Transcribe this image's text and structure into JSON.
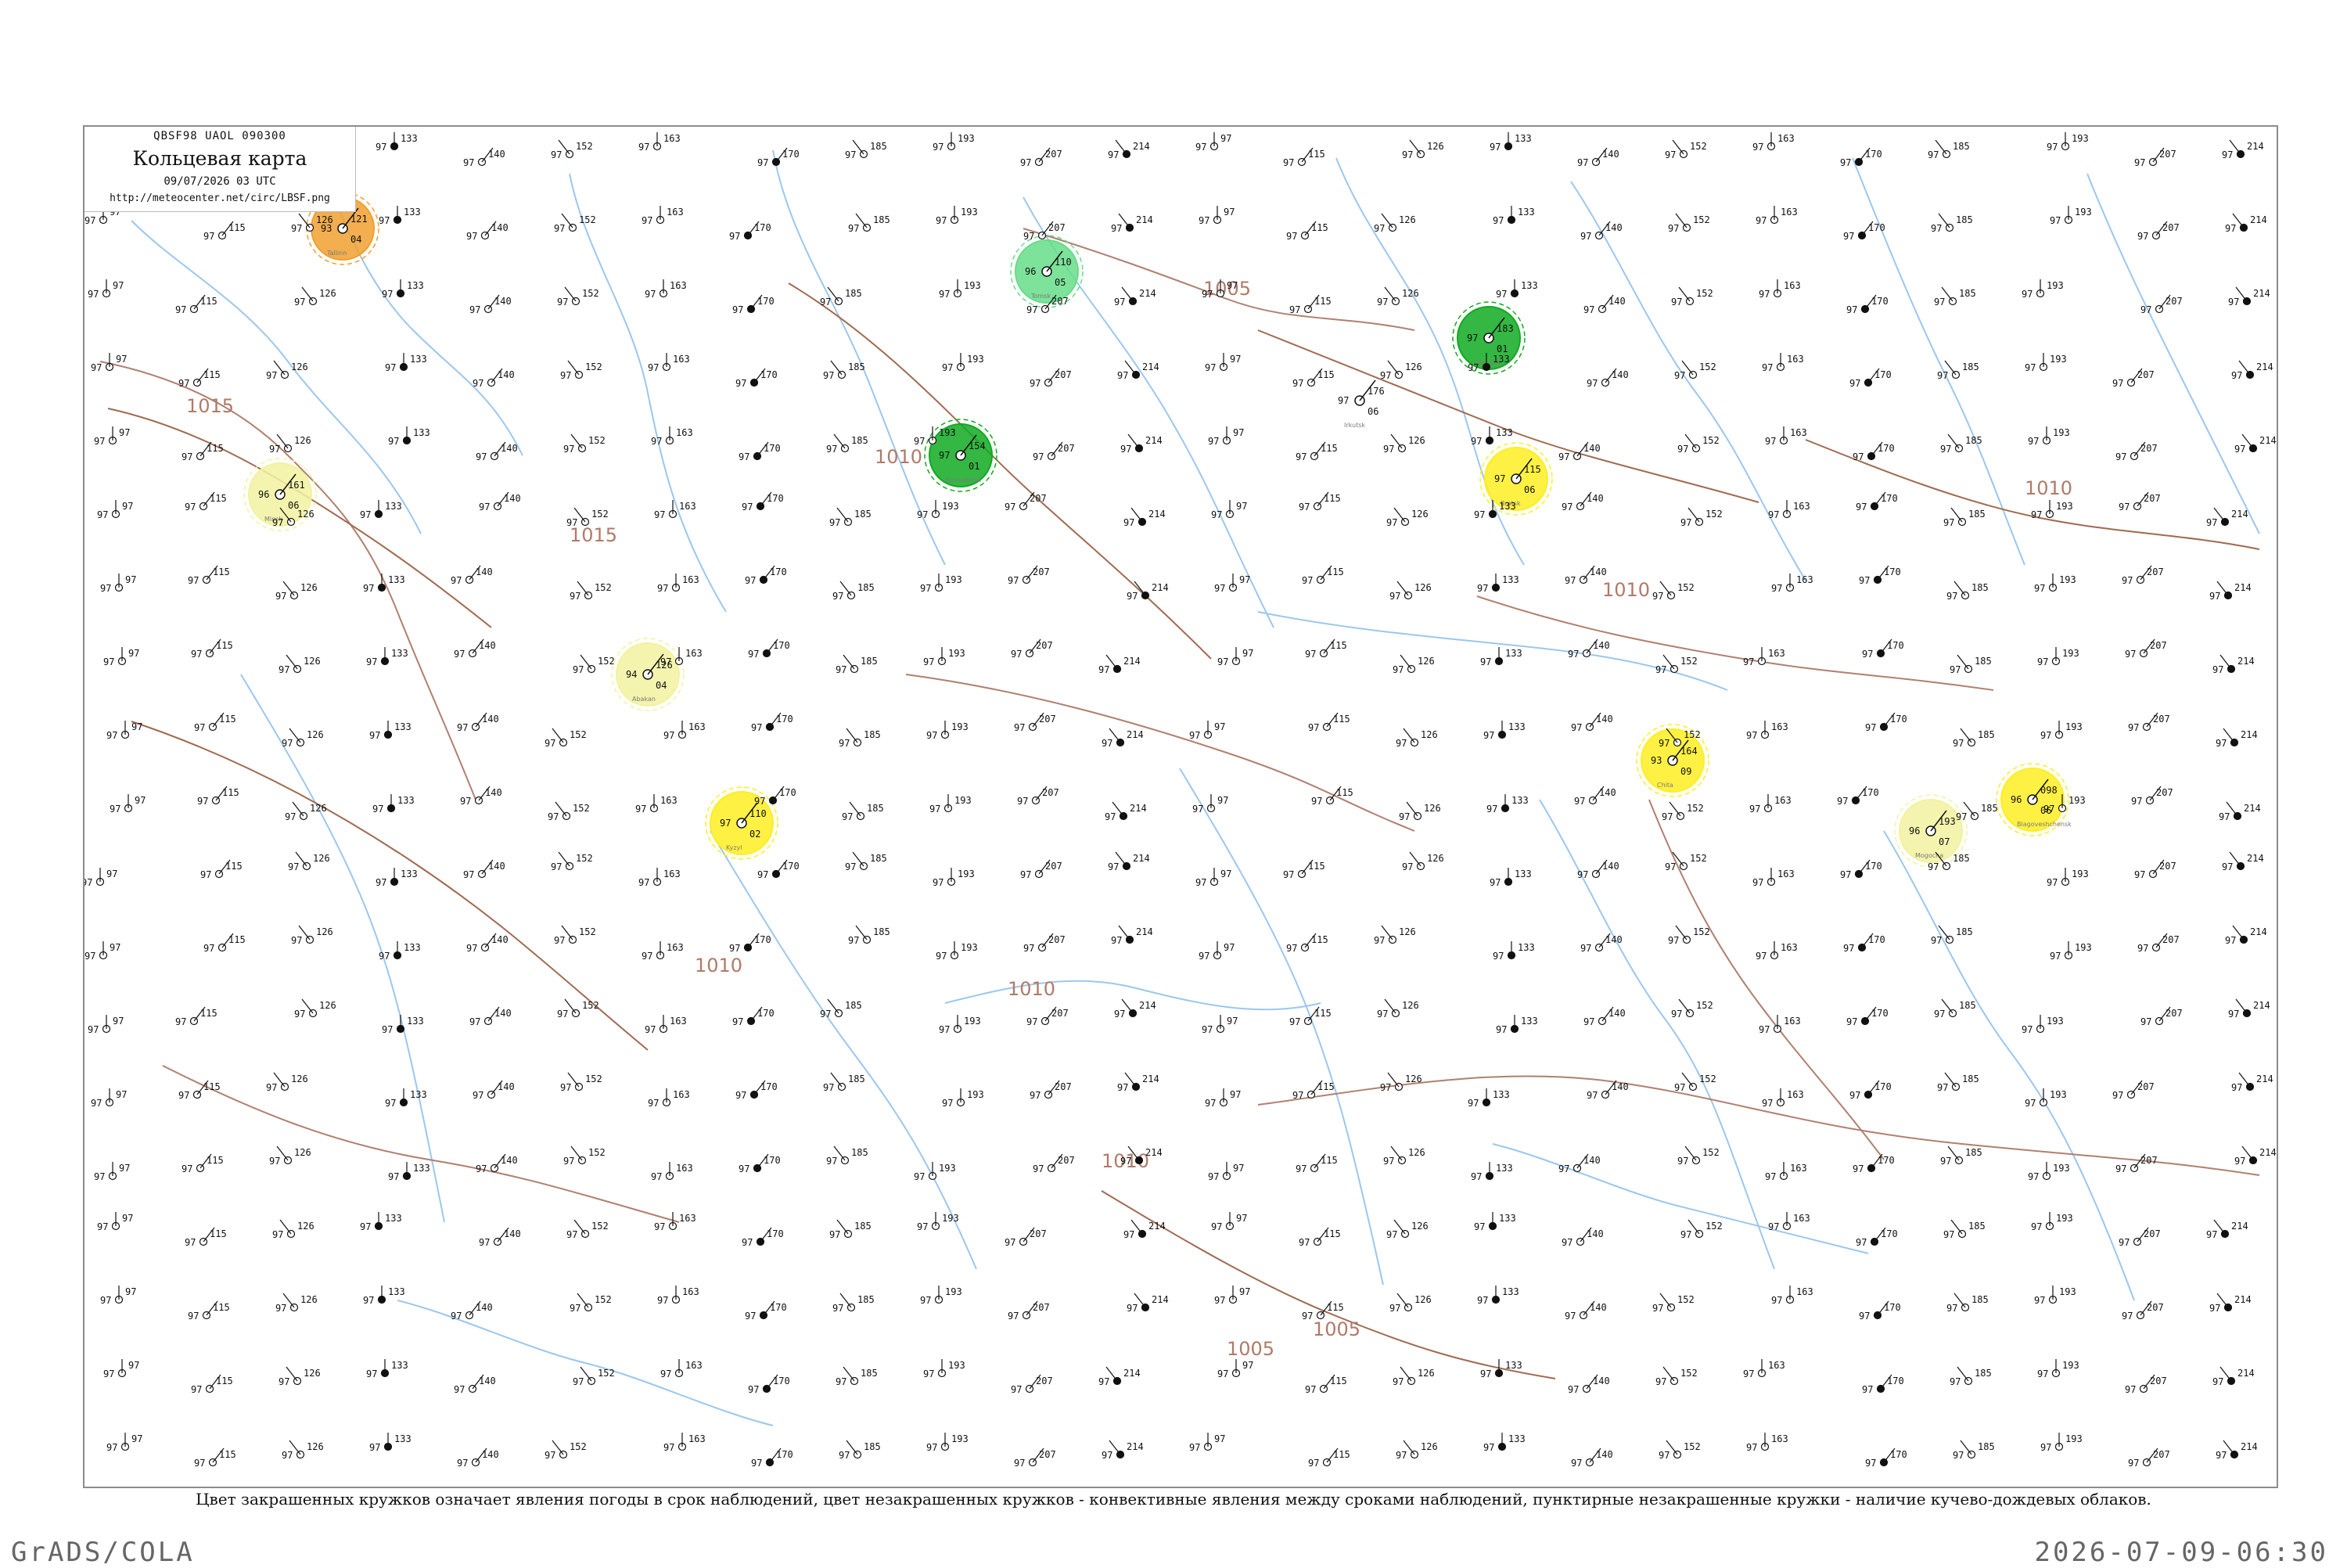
{
  "header": {
    "code": "QBSF98  UAOL  090300",
    "title": "Кольцевая карта",
    "date": "09/07/2026 03 UTC",
    "url": "http://meteocenter.net/circ/LBSF.png"
  },
  "legend_caption": "Цвет закрашенных кружков означает явления погоды в срок наблюдений, цвет незакрашенных кружков - конвективные явления между сроками наблюдений, пунктирные незакрашенные кружки - наличие кучево-дождевых облаков.",
  "footer": {
    "left": "GrADS/COLA",
    "right": "2026-07-09-06:30"
  },
  "colors": {
    "thunderstorm": "#11aa22",
    "rain": "#ffee22",
    "drizzle": "#f2f2a0",
    "haze": "#f0a030",
    "shower": "#66dd88",
    "isobar": "#a06a50",
    "border": "#b08070",
    "river": "#9cc7ee"
  },
  "isobars": [
    "1015",
    "1015",
    "1010",
    "1010",
    "1010",
    "1005",
    "1005",
    "1005",
    "1010",
    "1010",
    "1010"
  ],
  "stations": [
    {
      "p": "183",
      "t": "01",
      "td": "97",
      "wx": "thunderstorm",
      "name": "Ulan-Ude"
    },
    {
      "p": "176",
      "t": "06",
      "td": "97",
      "wx": "none",
      "name": "Irkutsk"
    },
    {
      "p": "115",
      "t": "06",
      "td": "97",
      "wx": "rain",
      "name": "Bratsk"
    },
    {
      "p": "164",
      "t": "09",
      "td": "93",
      "wx": "rain",
      "name": "Chita"
    },
    {
      "p": "193",
      "t": "07",
      "td": "96",
      "wx": "drizzle",
      "name": "Mogocha"
    },
    {
      "p": "110",
      "t": "02",
      "td": "97",
      "wx": "rain",
      "name": "Kyzyl"
    },
    {
      "p": "126",
      "t": "04",
      "td": "94",
      "wx": "drizzle",
      "name": "Abakan"
    },
    {
      "p": "161",
      "t": "06",
      "td": "96",
      "wx": "drizzle",
      "name": "Minsk"
    },
    {
      "p": "121",
      "t": "04",
      "td": "93",
      "wx": "haze",
      "name": "Tallinn"
    },
    {
      "p": "110",
      "t": "05",
      "td": "96",
      "wx": "shower",
      "name": "Tomsk"
    },
    {
      "p": "098",
      "t": "06",
      "td": "96",
      "wx": "rain",
      "name": "Blagoveshchensk"
    },
    {
      "p": "154",
      "t": "01",
      "td": "97",
      "wx": "thunderstorm",
      "name": "Novosibirsk"
    }
  ]
}
